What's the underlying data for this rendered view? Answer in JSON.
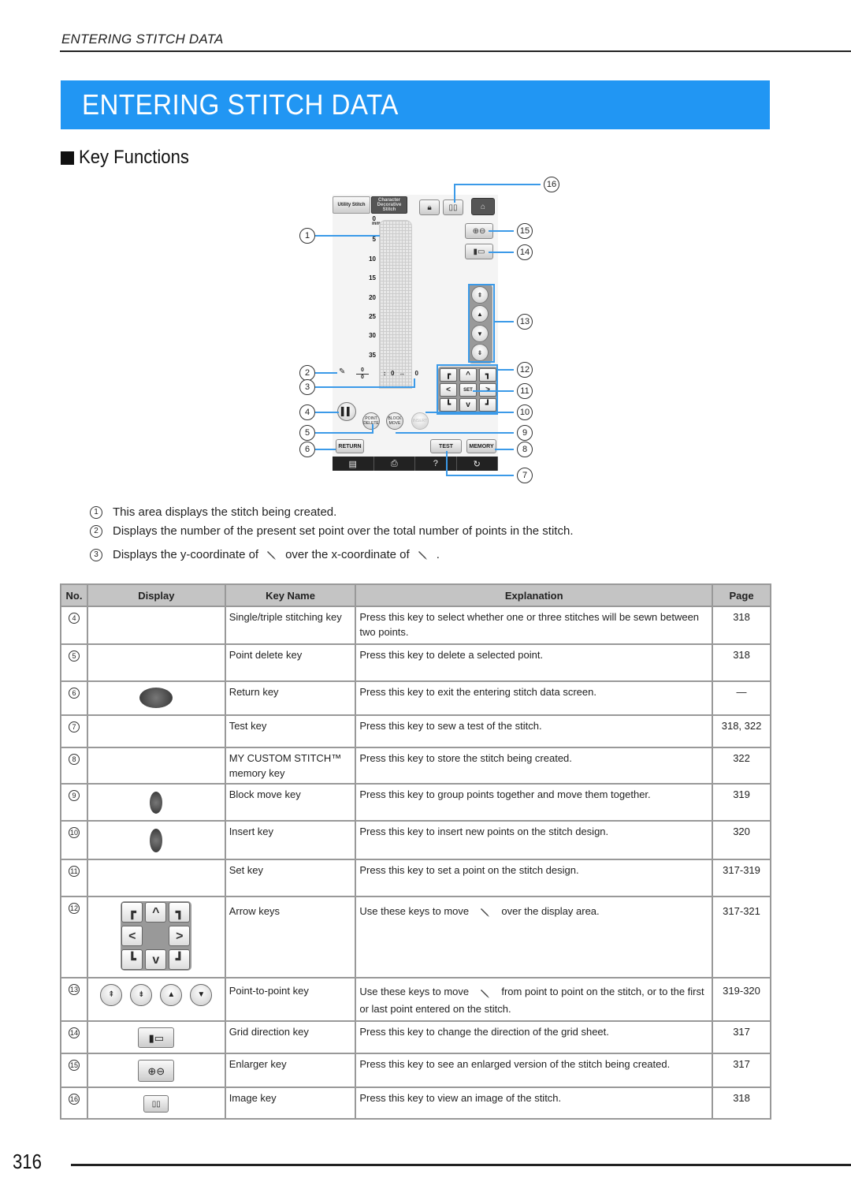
{
  "header": {
    "running_title": "ENTERING STITCH DATA",
    "banner_title": "ENTERING STITCH DATA",
    "section_title": "Key Functions"
  },
  "colors": {
    "banner": "#2196f3",
    "callout_line": "#3b9ae8",
    "table_header": "#c4c4c4"
  },
  "screen": {
    "tabs": {
      "utility": "Utility Stitch",
      "character": "Character Decorative Stitch"
    },
    "ruler_unit": "mm",
    "ruler": [
      "0",
      "5",
      "10",
      "15",
      "20",
      "25",
      "30",
      "35"
    ],
    "point_counter": {
      "current": "0",
      "total": "0"
    },
    "coords": {
      "y": "0",
      "x": "0"
    },
    "buttons": {
      "point_delete": "POINT DELETE",
      "block_move": "BLOCK MOVE",
      "insert": "INSERT",
      "set": "SET",
      "return": "RETURN",
      "test": "TEST",
      "memory": "MEMORY"
    },
    "bottom_bar": [
      "▤",
      "⎙",
      "?",
      "↻"
    ],
    "callouts": [
      "1",
      "2",
      "3",
      "4",
      "5",
      "6",
      "7",
      "8",
      "9",
      "10",
      "11",
      "12",
      "13",
      "14",
      "15",
      "16"
    ]
  },
  "notes": [
    {
      "num": "1",
      "text": "This area displays the stitch being created."
    },
    {
      "num": "2",
      "text": "Displays the number of the present set point over the total number of points in the stitch."
    },
    {
      "num": "3",
      "text_a": "Displays the y-coordinate of",
      "text_b": "over the x-coordinate of",
      "text_c": "."
    }
  ],
  "table": {
    "headers": [
      "No.",
      "Display",
      "Key Name",
      "Explanation",
      "Page"
    ],
    "rows": [
      {
        "no": "4",
        "key_name": "Single/triple stitching key",
        "explanation": "Press this key to select whether one or three stitches will be sewn between two points.",
        "page": "318"
      },
      {
        "no": "5",
        "key_name": "Point delete key",
        "explanation": "Press this key to delete a selected point.",
        "page": "318"
      },
      {
        "no": "6",
        "key_name": "Return key",
        "explanation": "Press this key to exit the entering stitch data screen.",
        "page": "—"
      },
      {
        "no": "7",
        "key_name": "Test key",
        "explanation": "Press this key to sew a test of the stitch.",
        "page": "318, 322"
      },
      {
        "no": "8",
        "key_name": "MY CUSTOM STITCH™ memory key",
        "explanation": "Press this key to store the stitch being created.",
        "page": "322"
      },
      {
        "no": "9",
        "key_name": "Block move key",
        "explanation": "Press this key to group points together and move them together.",
        "page": "319"
      },
      {
        "no": "10",
        "key_name": "Insert key",
        "explanation": "Press this key to insert new points on the stitch design.",
        "page": "320"
      },
      {
        "no": "11",
        "key_name": "Set key",
        "explanation": "Press this key to set a point on the stitch design.",
        "page": "317-319"
      },
      {
        "no": "12",
        "key_name": "Arrow keys",
        "explanation_a": "Use these keys to move",
        "explanation_b": "over the display area.",
        "page": "317-321"
      },
      {
        "no": "13",
        "key_name": "Point-to-point key",
        "explanation_a": "Use these keys to move",
        "explanation_b": "from point to point on the stitch, or to the first or last point entered on the stitch.",
        "page": "319-320"
      },
      {
        "no": "14",
        "key_name": "Grid direction key",
        "explanation": "Press this key to change the direction of the grid sheet.",
        "page": "317"
      },
      {
        "no": "15",
        "key_name": "Enlarger key",
        "explanation": "Press this key to see an enlarged version of the stitch being created.",
        "page": "317"
      },
      {
        "no": "16",
        "key_name": "Image key",
        "explanation": "Press this key to view an image of the stitch.",
        "page": "318"
      }
    ]
  },
  "footer": {
    "page_number": "316"
  }
}
